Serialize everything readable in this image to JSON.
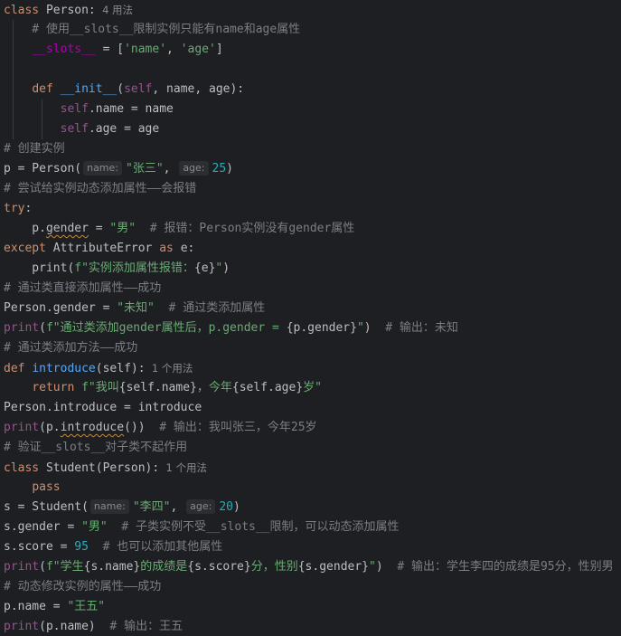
{
  "lines": [
    {
      "s": [
        {
          "t": "class ",
          "c": "kw"
        },
        {
          "t": "Person:"
        },
        {
          "t": "  4 用法",
          "c": "hint"
        }
      ]
    },
    {
      "s": [
        {
          "t": "    # 使用__slots__限制实例只能有name和age属性",
          "c": "cm"
        }
      ]
    },
    {
      "s": [
        {
          "t": "    "
        },
        {
          "t": "__slots__",
          "c": "dunder"
        },
        {
          "t": " = ["
        },
        {
          "t": "'name'",
          "c": "str"
        },
        {
          "t": ", "
        },
        {
          "t": "'age'",
          "c": "str"
        },
        {
          "t": "]"
        }
      ]
    },
    {
      "s": []
    },
    {
      "s": [
        {
          "t": "    "
        },
        {
          "t": "def ",
          "c": "kw"
        },
        {
          "t": "__init__",
          "c": "fn"
        },
        {
          "t": "("
        },
        {
          "t": "self",
          "c": "self"
        },
        {
          "t": ", name, age):"
        }
      ]
    },
    {
      "s": [
        {
          "t": "        "
        },
        {
          "t": "self",
          "c": "self"
        },
        {
          "t": ".name = name"
        }
      ]
    },
    {
      "s": [
        {
          "t": "        "
        },
        {
          "t": "self",
          "c": "self"
        },
        {
          "t": ".age = age"
        }
      ]
    },
    {
      "s": [
        {
          "t": "# 创建实例",
          "c": "cm"
        }
      ]
    },
    {
      "s": [
        {
          "t": "p = Person("
        },
        {
          "t": "name:",
          "c": "ph"
        },
        {
          "t": "\"张三\"",
          "c": "str"
        },
        {
          "t": ", "
        },
        {
          "t": "age:",
          "c": "ph"
        },
        {
          "t": "25",
          "c": "num"
        },
        {
          "t": ")"
        }
      ]
    },
    {
      "s": [
        {
          "t": "# 尝试给实例动态添加属性——会报错",
          "c": "cm"
        }
      ]
    },
    {
      "s": [
        {
          "t": "try",
          "c": "kw"
        },
        {
          "t": ":"
        }
      ]
    },
    {
      "s": [
        {
          "t": "    p."
        },
        {
          "t": "gender",
          "c": "squig"
        },
        {
          "t": " = "
        },
        {
          "t": "\"男\"",
          "c": "str"
        },
        {
          "t": "  # 报错：Person实例没有gender属性",
          "c": "cm"
        }
      ]
    },
    {
      "s": [
        {
          "t": "except ",
          "c": "kw"
        },
        {
          "t": "AttributeError "
        },
        {
          "t": "as ",
          "c": "kw"
        },
        {
          "t": "e:"
        }
      ]
    },
    {
      "s": [
        {
          "t": "    print("
        },
        {
          "t": "f\"实例添加属性报错：",
          "c": "str"
        },
        {
          "t": "{e}"
        },
        {
          "t": "\"",
          "c": "str"
        },
        {
          "t": ")"
        }
      ]
    },
    {
      "s": [
        {
          "t": "# 通过类直接添加属性——成功",
          "c": "cm"
        }
      ]
    },
    {
      "s": [
        {
          "t": "Person.gender = "
        },
        {
          "t": "\"未知\"",
          "c": "str"
        },
        {
          "t": "  # 通过类添加属性",
          "c": "cm"
        }
      ]
    },
    {
      "s": [
        {
          "t": "print",
          "c": "self"
        },
        {
          "t": "("
        },
        {
          "t": "f\"通过类添加gender属性后，p.gender = ",
          "c": "str"
        },
        {
          "t": "{p.gender}"
        },
        {
          "t": "\"",
          "c": "str"
        },
        {
          "t": ")"
        },
        {
          "t": "  # 输出：未知",
          "c": "cm"
        }
      ]
    },
    {
      "s": [
        {
          "t": "# 通过类添加方法——成功",
          "c": "cm"
        }
      ]
    },
    {
      "s": [
        {
          "t": "def ",
          "c": "kw"
        },
        {
          "t": "introduce",
          "c": "fn"
        },
        {
          "t": "(self):"
        },
        {
          "t": "  1 个用法",
          "c": "hint"
        }
      ]
    },
    {
      "s": [
        {
          "t": "    "
        },
        {
          "t": "return ",
          "c": "kw"
        },
        {
          "t": "f\"我叫",
          "c": "str"
        },
        {
          "t": "{self.name}"
        },
        {
          "t": "，今年",
          "c": "str"
        },
        {
          "t": "{self.age}"
        },
        {
          "t": "岁\"",
          "c": "str"
        }
      ]
    },
    {
      "s": [
        {
          "t": "Person.introduce = introduce"
        }
      ]
    },
    {
      "s": [
        {
          "t": "print",
          "c": "self"
        },
        {
          "t": "(p."
        },
        {
          "t": "introduce",
          "c": "squig"
        },
        {
          "t": "())"
        },
        {
          "t": "  # 输出：我叫张三，今年25岁",
          "c": "cm"
        }
      ]
    },
    {
      "s": [
        {
          "t": "# 验证__slots__对子类不起作用",
          "c": "cm"
        }
      ]
    },
    {
      "s": [
        {
          "t": "class ",
          "c": "kw"
        },
        {
          "t": "Student(Person):"
        },
        {
          "t": "  1 个用法",
          "c": "hint"
        }
      ]
    },
    {
      "s": [
        {
          "t": "    "
        },
        {
          "t": "pass",
          "c": "kw"
        }
      ]
    },
    {
      "s": [
        {
          "t": "s = Student("
        },
        {
          "t": "name:",
          "c": "ph"
        },
        {
          "t": "\"李四\"",
          "c": "str"
        },
        {
          "t": ", "
        },
        {
          "t": "age:",
          "c": "ph"
        },
        {
          "t": "20",
          "c": "num"
        },
        {
          "t": ")"
        }
      ]
    },
    {
      "s": [
        {
          "t": "s.gender = "
        },
        {
          "t": "\"男\"",
          "c": "str"
        },
        {
          "t": "  # 子类实例不受__slots__限制，可以动态添加属性",
          "c": "cm"
        }
      ]
    },
    {
      "s": [
        {
          "t": "s.score = "
        },
        {
          "t": "95",
          "c": "num"
        },
        {
          "t": "  # 也可以添加其他属性",
          "c": "cm"
        }
      ]
    },
    {
      "s": [
        {
          "t": "print",
          "c": "self"
        },
        {
          "t": "("
        },
        {
          "t": "f\"学生",
          "c": "str"
        },
        {
          "t": "{s.name}"
        },
        {
          "t": "的成绩是",
          "c": "str"
        },
        {
          "t": "{s.score}"
        },
        {
          "t": "分，性别",
          "c": "str"
        },
        {
          "t": "{s.gender}"
        },
        {
          "t": "\"",
          "c": "str"
        },
        {
          "t": ")"
        },
        {
          "t": "  # 输出：学生李四的成绩是95分，性别男",
          "c": "cm"
        }
      ]
    },
    {
      "s": [
        {
          "t": "# 动态修改实例的属性——成功",
          "c": "cm"
        }
      ]
    },
    {
      "s": [
        {
          "t": "p.name = "
        },
        {
          "t": "\"王五\"",
          "c": "str"
        }
      ]
    },
    {
      "s": [
        {
          "t": "print",
          "c": "self"
        },
        {
          "t": "(p.name)"
        },
        {
          "t": "  # 输出：王五",
          "c": "cm"
        }
      ]
    }
  ]
}
